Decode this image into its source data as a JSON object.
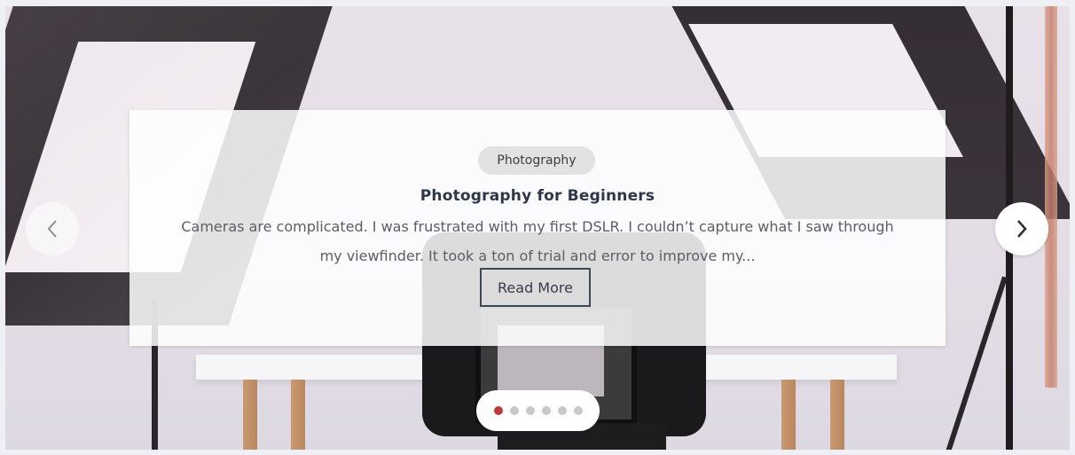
{
  "slide": {
    "category": "Photography",
    "title": "Photography for Beginners",
    "excerpt": "Cameras are complicated. I was frustrated with my first DSLR. I couldn’t capture what I saw through my viewfinder. It took a ton of trial and error to improve my...",
    "button_label": "Read More"
  },
  "navigation": {
    "prev_icon": "chevron-left-icon",
    "next_icon": "chevron-right-icon"
  },
  "pagination": {
    "total": 6,
    "active_index": 0
  },
  "colors": {
    "active_dot": "#c0393b",
    "inactive_dot": "#c9c9c9",
    "title": "#2e3748",
    "button_border": "#3f4654"
  }
}
